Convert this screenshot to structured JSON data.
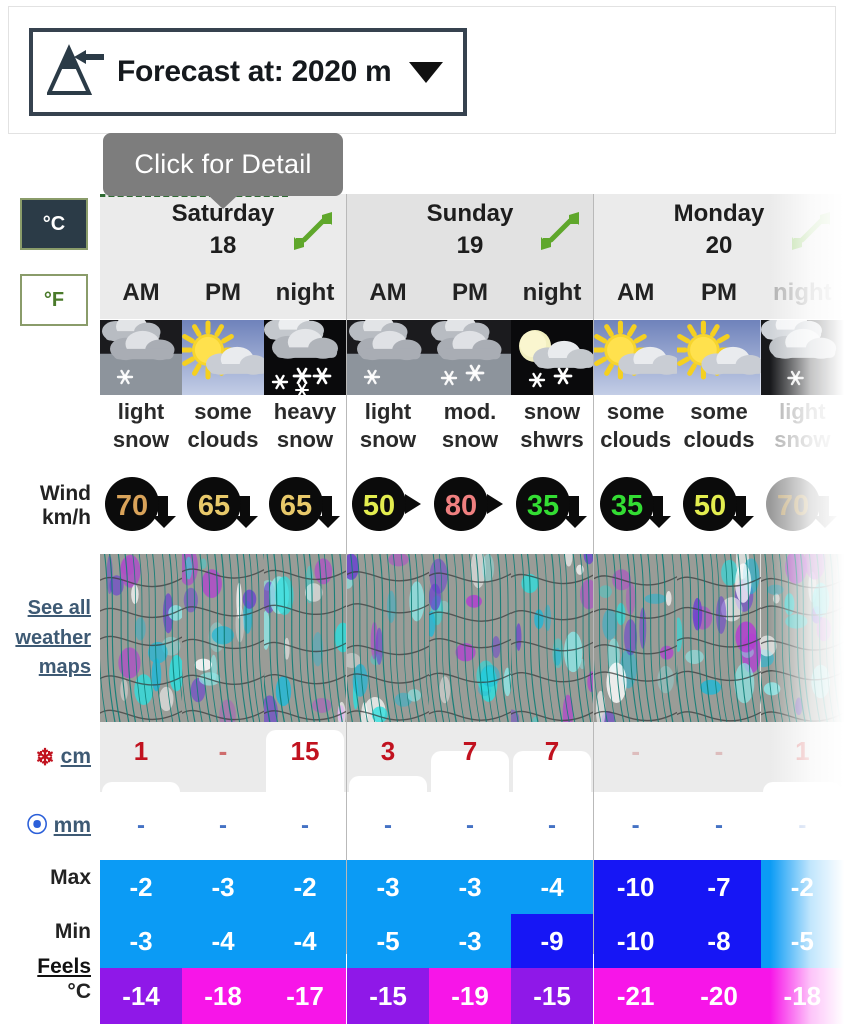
{
  "elevation": {
    "label": "Forecast at: 2020 m",
    "icon": "mountain-icon",
    "caret": "chevron-down-icon"
  },
  "tooltip": {
    "text": "Click for Detail"
  },
  "units": {
    "celsius": "°C",
    "fahrenheit": "°F",
    "active": "°C"
  },
  "sidebar": {
    "wind_label_line1": "Wind",
    "wind_label_line2": "km/h",
    "maps_link_line1": "See all",
    "maps_link_line2": "weather",
    "maps_link_line3": "maps",
    "snow_unit": "cm",
    "rain_unit": "mm",
    "max_label": "Max",
    "min_label": "Min",
    "feels_label": "Feels",
    "feels_unit": "°C"
  },
  "periods": [
    "AM",
    "PM",
    "night"
  ],
  "days": [
    {
      "name": "Saturday",
      "number": "18",
      "expand_icon": "expand-arrows-icon",
      "cells": [
        {
          "period": "AM",
          "condition_line1": "light",
          "condition_line2": "snow",
          "icon": "cloudy-light-snow-icon",
          "icon_bg": "day-overcast",
          "wind": "70",
          "wind_color": "#d9a35a",
          "wind_dir": "se",
          "wind_disabled": false,
          "snow": "1",
          "snow_bar_pct": 12,
          "rain": "-",
          "max": "-2",
          "max_bg": "#0b9bf5",
          "min": "-3",
          "min_bg": "#0b9bf5",
          "feels": "-14",
          "feels_bg": "#8f18e8"
        },
        {
          "period": "PM",
          "condition_line1": "some",
          "condition_line2": "clouds",
          "icon": "sun-clouds-icon",
          "icon_bg": "day-sunny",
          "wind": "65",
          "wind_color": "#e8c96a",
          "wind_dir": "se",
          "wind_disabled": false,
          "snow": "-",
          "snow_bar_pct": 0,
          "rain": "-",
          "max": "-3",
          "max_bg": "#0b9bf5",
          "min": "-4",
          "min_bg": "#0b9bf5",
          "feels": "-18",
          "feels_bg": "#f715e8"
        },
        {
          "period": "night",
          "condition_line1": "heavy",
          "condition_line2": "snow",
          "icon": "night-heavy-snow-icon",
          "icon_bg": "night-dark",
          "wind": "65",
          "wind_color": "#e8c96a",
          "wind_dir": "se",
          "wind_disabled": false,
          "snow": "15",
          "snow_bar_pct": 100,
          "rain": "-",
          "max": "-2",
          "max_bg": "#0b9bf5",
          "min": "-4",
          "min_bg": "#0b9bf5",
          "feels": "-17",
          "feels_bg": "#f715e8"
        }
      ]
    },
    {
      "name": "Sunday",
      "number": "19",
      "expand_icon": "expand-arrows-icon",
      "cells": [
        {
          "period": "AM",
          "condition_line1": "light",
          "condition_line2": "snow",
          "icon": "cloudy-light-snow-icon",
          "icon_bg": "day-overcast",
          "wind": "50",
          "wind_color": "#e3ed4f",
          "wind_dir": "e",
          "wind_disabled": false,
          "snow": "3",
          "snow_bar_pct": 26,
          "rain": "-",
          "max": "-3",
          "max_bg": "#0b9bf5",
          "min": "-5",
          "min_bg": "#0b9bf5",
          "feels": "-15",
          "feels_bg": "#8f18e8"
        },
        {
          "period": "PM",
          "condition_line1": "mod.",
          "condition_line2": "snow",
          "icon": "cloudy-mod-snow-icon",
          "icon_bg": "day-overcast",
          "wind": "80",
          "wind_color": "#f08080",
          "wind_dir": "e",
          "wind_disabled": false,
          "snow": "7",
          "snow_bar_pct": 66,
          "rain": "-",
          "max": "-3",
          "max_bg": "#0b9bf5",
          "min": "-3",
          "min_bg": "#0b9bf5",
          "feels": "-19",
          "feels_bg": "#f715e8"
        },
        {
          "period": "night",
          "condition_line1": "snow",
          "condition_line2": "shwrs",
          "icon": "moon-snow-showers-icon",
          "icon_bg": "night-dark",
          "wind": "35",
          "wind_color": "#33dd33",
          "wind_dir": "se",
          "wind_disabled": false,
          "snow": "7",
          "snow_bar_pct": 66,
          "rain": "-",
          "max": "-4",
          "max_bg": "#0b9bf5",
          "min": "-9",
          "min_bg": "#1616f5",
          "feels": "-15",
          "feels_bg": "#8f18e8"
        }
      ]
    },
    {
      "name": "Monday",
      "number": "20",
      "expand_icon": "expand-arrows-icon",
      "cells": [
        {
          "period": "AM",
          "condition_line1": "some",
          "condition_line2": "clouds",
          "icon": "sun-clouds-icon",
          "icon_bg": "day-sunny",
          "wind": "35",
          "wind_color": "#33dd33",
          "wind_dir": "se",
          "wind_disabled": false,
          "snow": "-",
          "snow_bar_pct": 0,
          "rain": "-",
          "max": "-10",
          "max_bg": "#1616f5",
          "min": "-10",
          "min_bg": "#1616f5",
          "feels": "-21",
          "feels_bg": "#f715e8"
        },
        {
          "period": "PM",
          "condition_line1": "some",
          "condition_line2": "clouds",
          "icon": "sun-clouds-icon",
          "icon_bg": "day-sunny",
          "wind": "50",
          "wind_color": "#e3ed4f",
          "wind_dir": "se",
          "wind_disabled": false,
          "snow": "-",
          "snow_bar_pct": 0,
          "rain": "-",
          "max": "-7",
          "max_bg": "#1616f5",
          "min": "-8",
          "min_bg": "#1616f5",
          "feels": "-20",
          "feels_bg": "#f715e8"
        },
        {
          "period": "night",
          "condition_line1": "light",
          "condition_line2": "snow",
          "icon": "night-light-snow-icon",
          "icon_bg": "night-dark",
          "wind": "70",
          "wind_color": "#d9a35a",
          "wind_dir": "se",
          "wind_disabled": true,
          "snow": "1",
          "snow_bar_pct": 12,
          "rain": "-",
          "max": "-2",
          "max_bg": "#0b9bf5",
          "min": "-5",
          "min_bg": "#0b9bf5",
          "feels": "-18",
          "feels_bg": "#f715e8"
        }
      ]
    }
  ],
  "colors": {
    "accent_green": "#5fa72b",
    "header_bg": "#ebebeb",
    "snow_red": "#c1121f",
    "rain_blue": "#4472c4",
    "link_blue": "#3e5a74"
  }
}
